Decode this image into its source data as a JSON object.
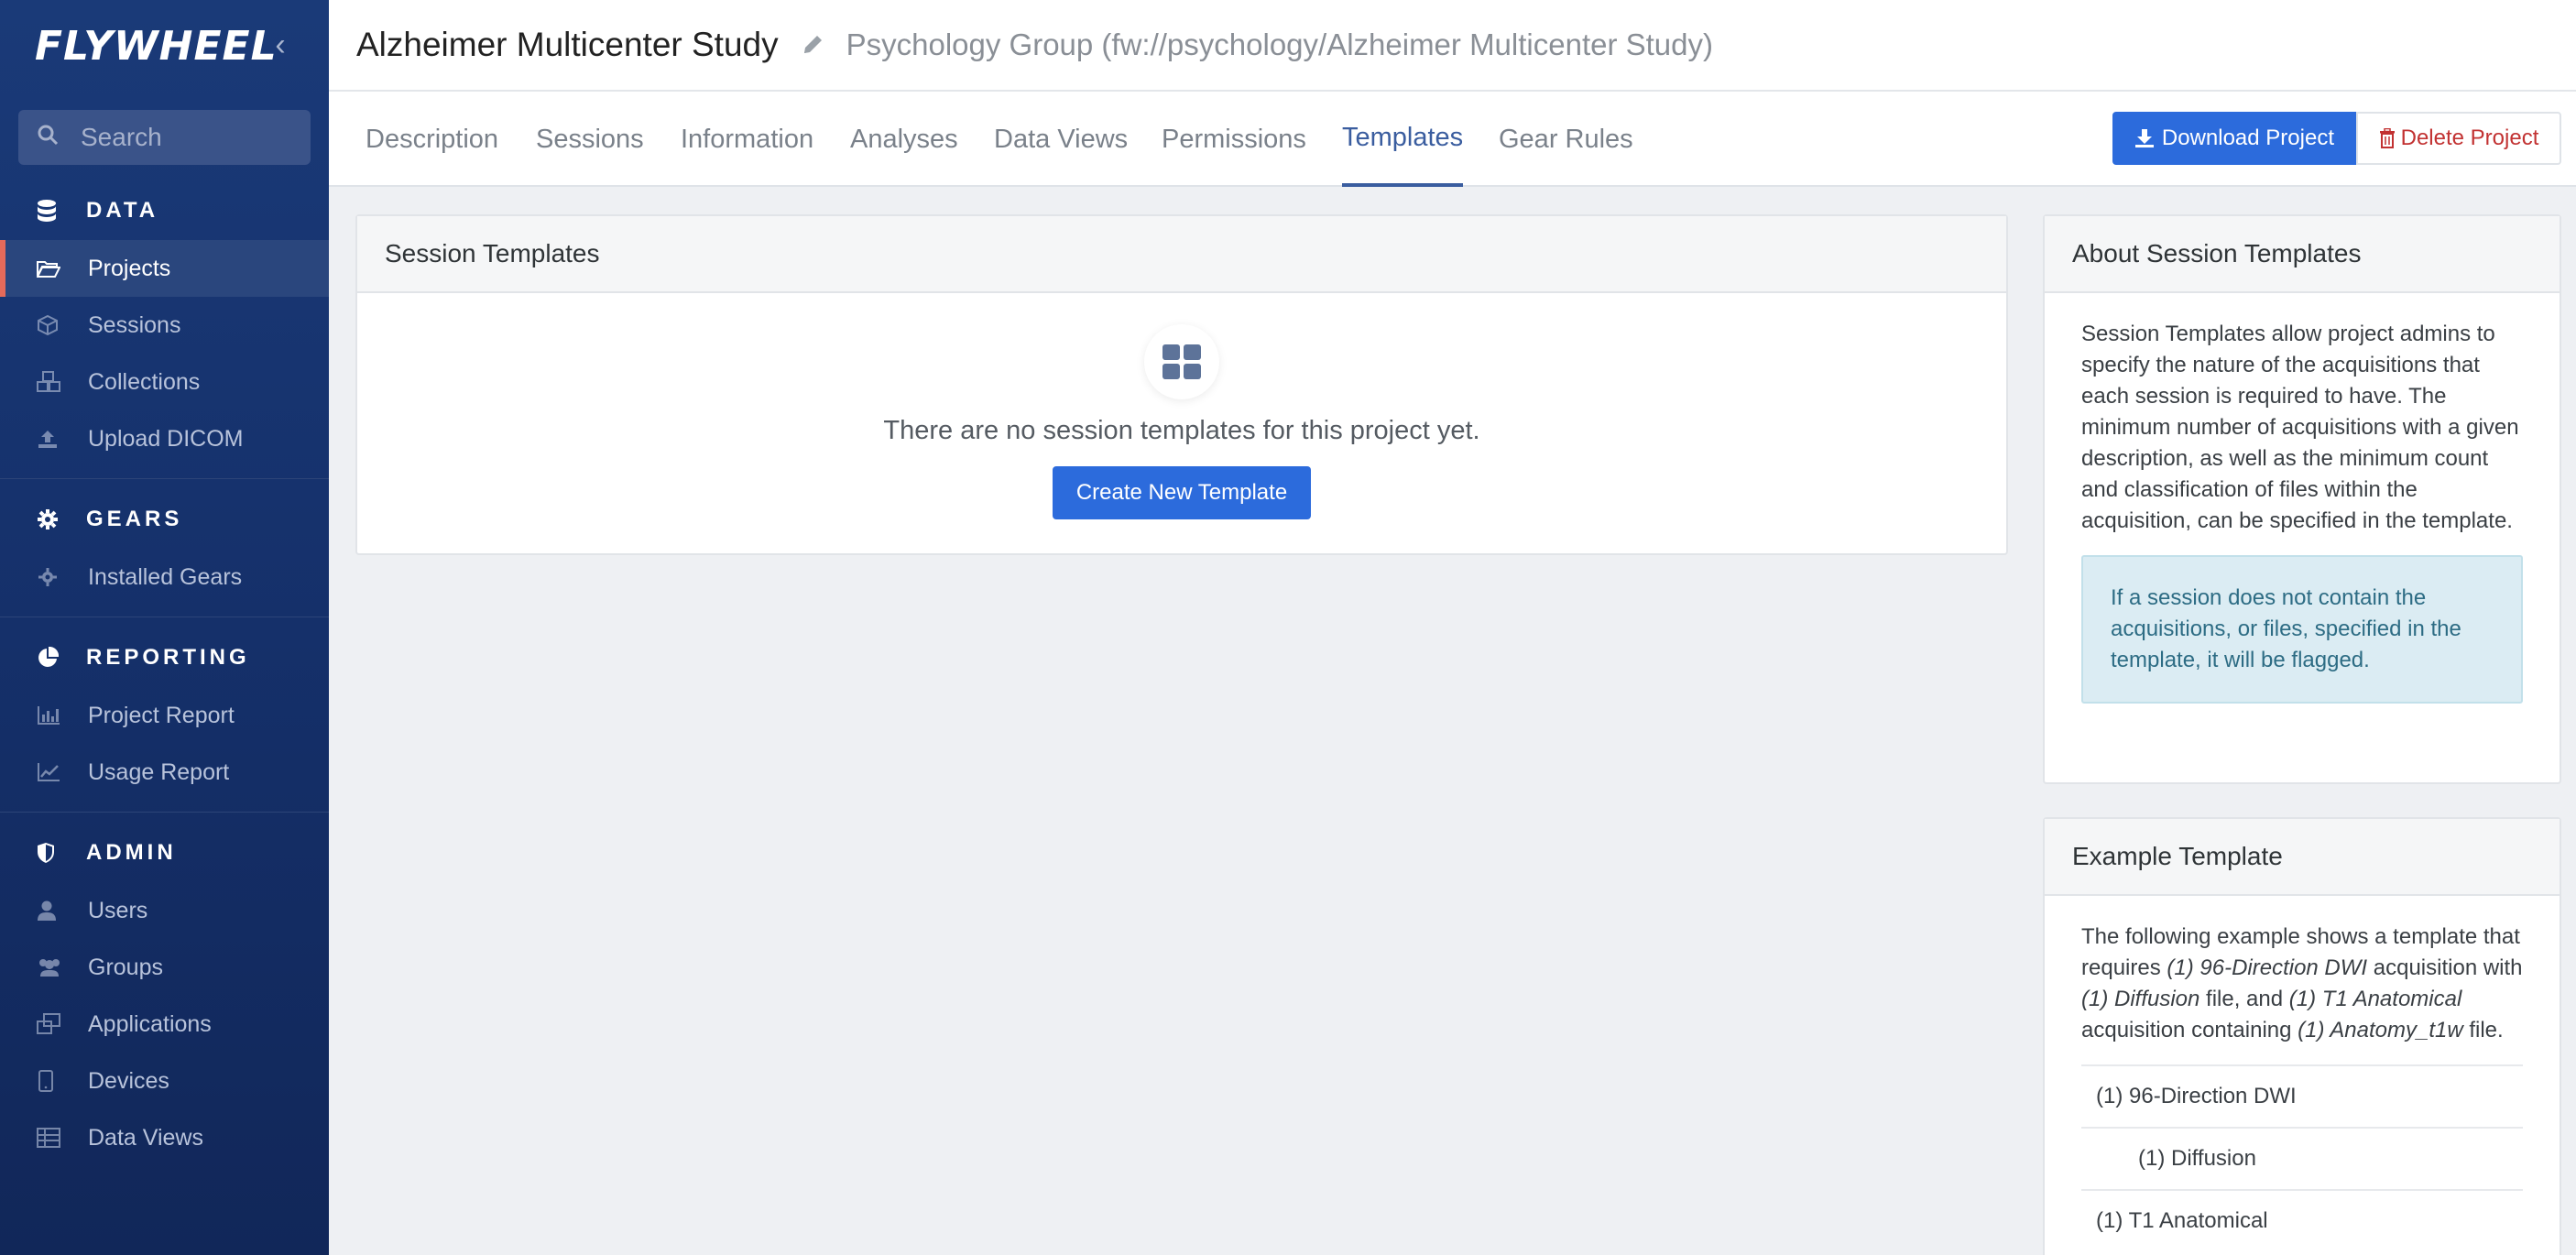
{
  "sidebar": {
    "logo": "FLYWHEEL",
    "search_placeholder": "Search",
    "sections": {
      "data": "DATA",
      "gears": "GEARS",
      "reporting": "REPORTING",
      "admin": "ADMIN"
    },
    "data_items": [
      "Projects",
      "Sessions",
      "Collections",
      "Upload DICOM"
    ],
    "gears_items": [
      "Installed Gears"
    ],
    "reporting_items": [
      "Project Report",
      "Usage Report"
    ],
    "admin_items": [
      "Users",
      "Groups",
      "Applications",
      "Devices",
      "Data Views"
    ]
  },
  "header": {
    "title": "Alzheimer Multicenter Study",
    "subtitle": "Psychology Group (fw://psychology/Alzheimer Multicenter Study)"
  },
  "tabs": [
    "Description",
    "Sessions",
    "Information",
    "Analyses",
    "Data Views",
    "Permissions",
    "Templates",
    "Gear Rules"
  ],
  "active_tab": "Templates",
  "actions": {
    "download": "Download Project",
    "delete": "Delete Project"
  },
  "main": {
    "panel_title": "Session Templates",
    "empty_text": "There are no session templates for this project yet.",
    "create_button": "Create New Template"
  },
  "about": {
    "title": "About Session Templates",
    "body": "Session Templates allow project admins to specify the nature of the acquisitions that each session is required to have. The minimum number of acquisitions with a given description, as well as the minimum count and classification of files within the acquisition, can be specified in the template.",
    "info": "If a session does not contain the acquisitions, or files, specified in the template, it will be flagged."
  },
  "example": {
    "title": "Example Template",
    "intro_1": "The following example shows a template that requires ",
    "em_1": "(1) 96-Direction DWI",
    "intro_2": " acquisition with ",
    "em_2": "(1) Diffusion",
    "intro_3": " file, and ",
    "em_3": "(1) T1 Anatomical",
    "intro_4": " acquisition containing ",
    "em_4": "(1) Anatomy_t1w",
    "intro_5": " file.",
    "rows": [
      "(1) 96-Direction DWI",
      "(1) Diffusion",
      "(1) T1 Anatomical"
    ]
  },
  "colors": {
    "sidebar_bg": "#15306a",
    "accent": "#2c6bdc",
    "active_tab": "#3a5d9f",
    "danger": "#c23232",
    "active_marker": "#e46a5a"
  }
}
